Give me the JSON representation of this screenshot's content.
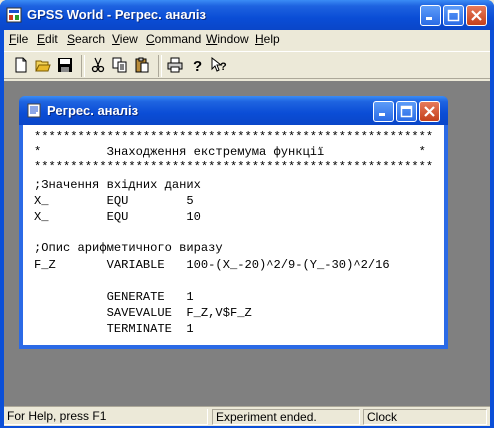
{
  "app": {
    "title": "GPSS World - Регрес. аналіз"
  },
  "menu": {
    "items": [
      {
        "label": "File",
        "accel": "F"
      },
      {
        "label": "Edit",
        "accel": "E"
      },
      {
        "label": "Search",
        "accel": "S"
      },
      {
        "label": "View",
        "accel": "V"
      },
      {
        "label": "Command",
        "accel": "C"
      },
      {
        "label": "Window",
        "accel": "W"
      },
      {
        "label": "Help",
        "accel": "H"
      }
    ]
  },
  "toolbar": {
    "buttons": [
      "new-file-icon",
      "open-folder-icon",
      "save-disk-icon",
      "cut-scissors-icon",
      "copy-icon",
      "paste-clipboard-icon",
      "print-icon",
      "help-icon",
      "context-help-icon"
    ]
  },
  "child_window": {
    "title": "Регрес. аналіз",
    "lines": [
      "*******************************************************",
      "*         Знаходження екстремума функції             *",
      "*******************************************************",
      ";Значення вхідних даних",
      "X_        EQU        5",
      "X_        EQU        10",
      "",
      ";Опис арифметичного виразу",
      "F_Z       VARIABLE   100-(X_-20)^2/9-(Y_-30)^2/16",
      "",
      "          GENERATE   1",
      "          SAVEVALUE  F_Z,V$F_Z",
      "          TERMINATE  1"
    ]
  },
  "statusbar": {
    "help": "For Help, press F1",
    "status": "Experiment ended.",
    "clock": "Clock"
  },
  "colors": {
    "titlebar": "#0a4dd6",
    "face": "#ece9d8",
    "mdi_background": "#808080",
    "close_button": "#c4401c"
  }
}
